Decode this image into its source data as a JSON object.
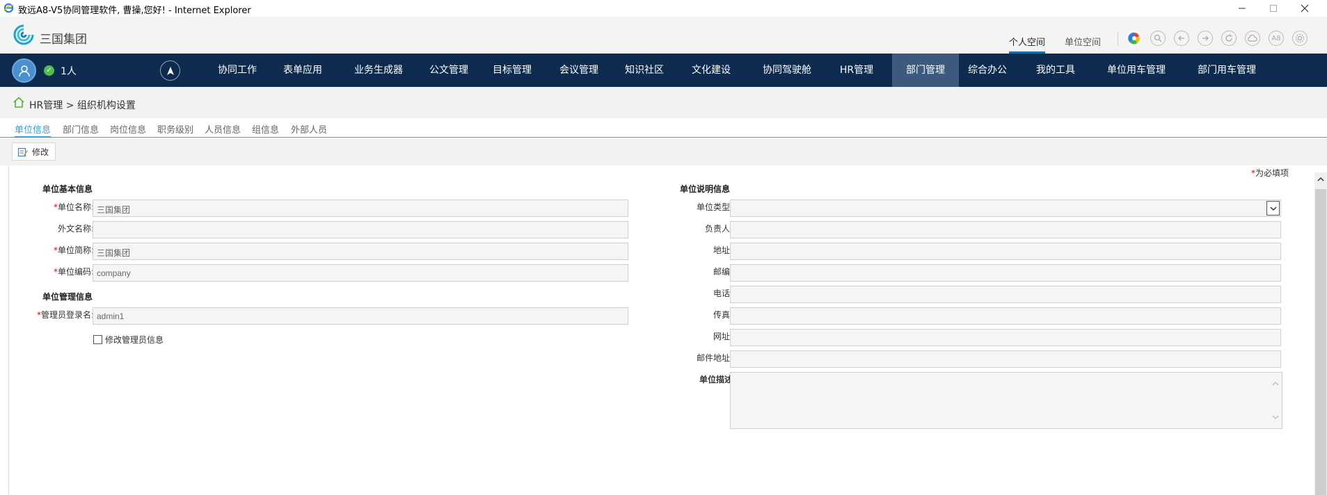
{
  "window": {
    "title": "致远A8-V5协同管理软件, 曹操,您好! - Internet Explorer"
  },
  "header": {
    "brand": "三国集团",
    "space_tabs": [
      "个人空间",
      "单位空间"
    ],
    "icons": [
      "color-wheel-icon",
      "search-icon",
      "back-icon",
      "forward-icon",
      "refresh-icon",
      "cloud-icon",
      "a8-icon",
      "settings-icon"
    ],
    "a8_label": "A8"
  },
  "navbar": {
    "online_count": "1人",
    "menu": [
      "协同工作",
      "表单应用",
      "业务生成器",
      "公文管理",
      "目标管理",
      "会议管理",
      "知识社区",
      "文化建设",
      "协同驾驶舱",
      "HR管理",
      "部门管理",
      "综合办公",
      "我的工具",
      "单位用车管理",
      "部门用车管理"
    ],
    "active_index": 10
  },
  "breadcrumb": {
    "text": "HR管理 > 组织机构设置"
  },
  "subtabs": [
    "单位信息",
    "部门信息",
    "岗位信息",
    "职务级别",
    "人员信息",
    "组信息",
    "外部人员"
  ],
  "toolbar": {
    "edit_label": "修改"
  },
  "form": {
    "required_note": "为必填项",
    "left": {
      "basic_title": "单位基本信息",
      "name_label": "单位名称:",
      "name_value": "三国集团",
      "foreign_name_label": "外文名称:",
      "foreign_name_value": "",
      "short_name_label": "单位简称:",
      "short_name_value": "三国集团",
      "code_label": "单位编码:",
      "code_value": "company",
      "manage_title": "单位管理信息",
      "admin_label": "管理员登录名:",
      "admin_value": "admin1",
      "modify_admin_label": "修改管理员信息"
    },
    "right": {
      "desc_title": "单位说明信息",
      "type_label": "单位类型:",
      "owner_label": "负责人:",
      "address_label": "地址:",
      "zip_label": "邮编:",
      "phone_label": "电话:",
      "fax_label": "传真:",
      "website_label": "网址:",
      "email_label": "邮件地址:",
      "description_label": "单位描述"
    }
  },
  "colors": {
    "navbar_bg": "#0d2a4f",
    "nav_active_bg": "#3b5a7e",
    "accent": "#3b9dd8"
  }
}
